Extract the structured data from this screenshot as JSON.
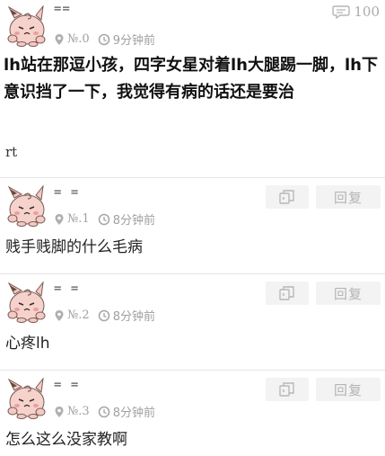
{
  "post": {
    "username": "==",
    "floor": "№.0",
    "time": "9分钟前",
    "reply_count": "100",
    "title": "lh站在那逗小孩，四字女星对着lh大腿踢一脚，lh下意识挡了一下，我觉得有病的话还是要治",
    "body": "rt"
  },
  "replies": [
    {
      "username": "= =",
      "floor": "№.1",
      "time": "8分钟前",
      "text": "贱手贱脚的什么毛病",
      "reply_label": "回复"
    },
    {
      "username": "= =",
      "floor": "№.2",
      "time": "8分钟前",
      "text": "心疼lh",
      "reply_label": "回复"
    },
    {
      "username": "= =",
      "floor": "№.3",
      "time": "8分钟前",
      "text": "怎么这么没家教啊",
      "reply_label": "回复"
    }
  ],
  "icons": {
    "avatar": "pink-clefairy-avatar",
    "location": "map-pin-icon",
    "time": "clock-icon",
    "comments": "speech-bubble-icon",
    "quote": "quote-copy-icon"
  },
  "colors": {
    "avatar_pink": "#f4c9c4",
    "meta_gray": "#a0a0a0",
    "button_bg": "#f3f3f3"
  }
}
